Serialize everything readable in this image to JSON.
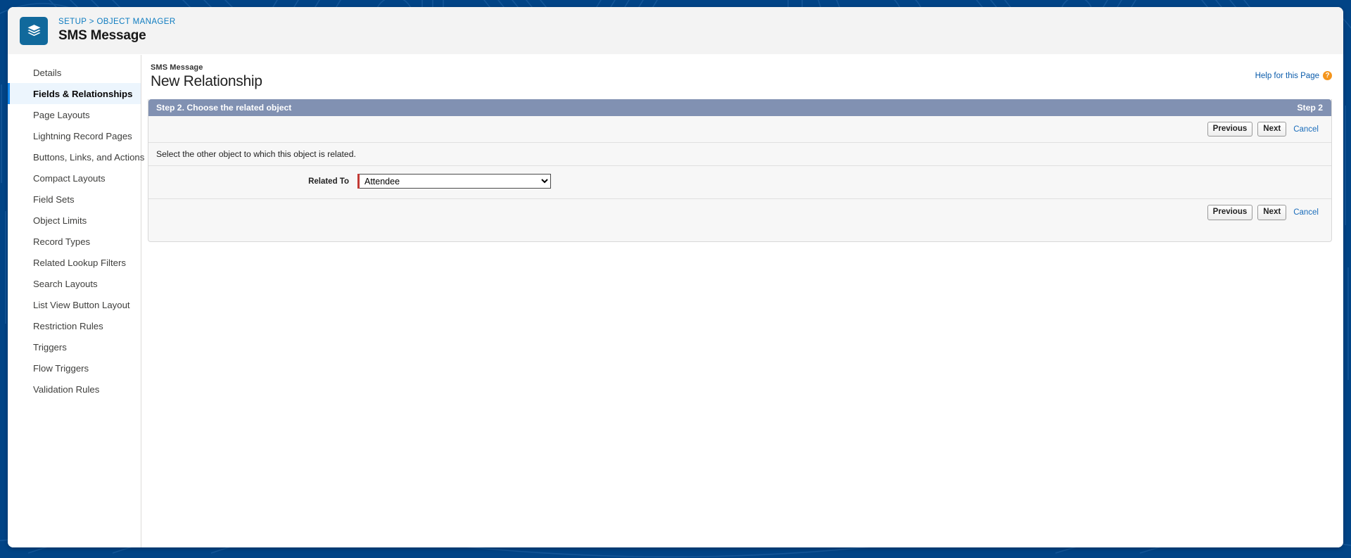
{
  "header": {
    "icon": "stacked-layers-icon",
    "breadcrumb": "SETUP > OBJECT MANAGER",
    "title": "SMS Message",
    "icon_color": "#11699c",
    "breadcrumb_color": "#0e7cc0"
  },
  "sidebar": {
    "items": [
      {
        "label": "Details",
        "active": false
      },
      {
        "label": "Fields & Relationships",
        "active": true
      },
      {
        "label": "Page Layouts",
        "active": false
      },
      {
        "label": "Lightning Record Pages",
        "active": false
      },
      {
        "label": "Buttons, Links, and Actions",
        "active": false
      },
      {
        "label": "Compact Layouts",
        "active": false
      },
      {
        "label": "Field Sets",
        "active": false
      },
      {
        "label": "Object Limits",
        "active": false
      },
      {
        "label": "Record Types",
        "active": false
      },
      {
        "label": "Related Lookup Filters",
        "active": false
      },
      {
        "label": "Search Layouts",
        "active": false
      },
      {
        "label": "List View Button Layout",
        "active": false
      },
      {
        "label": "Restriction Rules",
        "active": false
      },
      {
        "label": "Triggers",
        "active": false
      },
      {
        "label": "Flow Triggers",
        "active": false
      },
      {
        "label": "Validation Rules",
        "active": false
      }
    ],
    "active_accent": "#1589ee",
    "active_bg": "#ecf5fd"
  },
  "content": {
    "context_label": "SMS Message",
    "page_heading": "New Relationship",
    "help_link": "Help for this Page",
    "help_icon": "question-mark-icon",
    "help_icon_color": "#f4951d"
  },
  "step_panel": {
    "step_title": "Step 2. Choose the related object",
    "step_indicator": "Step 2",
    "bar_color": "#8191b2",
    "instruction": "Select the other object to which this object is related.",
    "buttons": {
      "previous": "Previous",
      "next": "Next",
      "cancel": "Cancel"
    },
    "field": {
      "label": "Related To",
      "required": true,
      "required_color": "#c23934",
      "selected_value": "Attendee",
      "options": [
        "Attendee"
      ]
    }
  }
}
